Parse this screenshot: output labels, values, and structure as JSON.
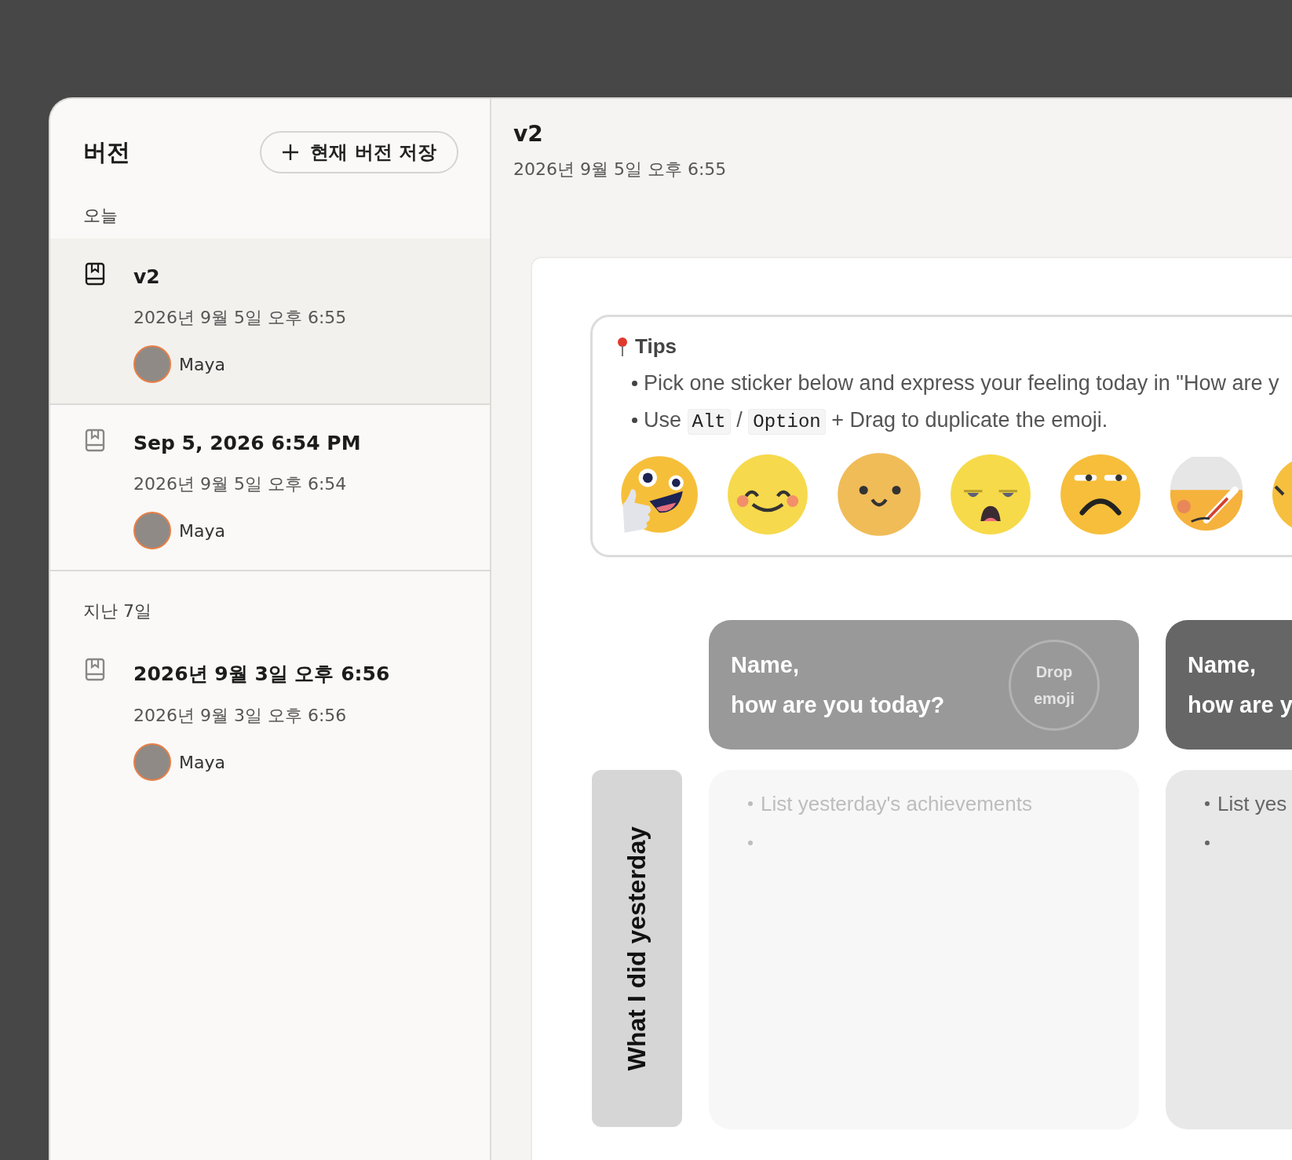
{
  "sidebar": {
    "title": "버전",
    "save_button": "현재 버전 저장",
    "groups": [
      {
        "label": "오늘",
        "items": [
          {
            "title": "v2",
            "timestamp": "2026년 9월 5일 오후 6:55",
            "author": "Maya",
            "selected": true
          },
          {
            "title": "Sep 5, 2026 6:54 PM",
            "timestamp": "2026년 9월 5일 오후 6:54",
            "author": "Maya",
            "selected": false
          }
        ]
      },
      {
        "label": "지난 7일",
        "items": [
          {
            "title": "2026년 9월 3일 오후 6:56",
            "timestamp": "2026년 9월 3일 오후 6:56",
            "author": "Maya",
            "selected": false
          }
        ]
      }
    ]
  },
  "preview": {
    "title": "v2",
    "timestamp": "2026년 9월 5일 오후 6:55",
    "tips": {
      "title": "Tips",
      "items": [
        {
          "kind": "plain",
          "text": "Pick one sticker below and express your feeling today in \"How are y"
        },
        {
          "kind": "keys",
          "before": "Use",
          "keys": [
            "Alt",
            "Option"
          ],
          "separator": "/",
          "after": "+ Drag to duplicate the emoji."
        }
      ],
      "stickers": [
        {
          "kind": "thumbs-up"
        },
        {
          "kind": "blushing"
        },
        {
          "kind": "smile"
        },
        {
          "kind": "tired"
        },
        {
          "kind": "frown"
        },
        {
          "kind": "sick"
        },
        {
          "kind": "edge"
        }
      ]
    },
    "row_label": "What I did yesterday",
    "cards": [
      {
        "kind": "light",
        "line1": "Name,",
        "line2": "how are you today?",
        "drop_zone": "Drop emoji"
      },
      {
        "kind": "dark",
        "line1": "Name,",
        "line2": "how are y"
      }
    ],
    "lists": [
      {
        "kind": "light",
        "bullets": [
          {
            "kind": "text",
            "text": "List yesterday's achievements"
          },
          {
            "kind": "empty"
          }
        ]
      },
      {
        "kind": "dark",
        "bullets": [
          {
            "kind": "text",
            "text": "List yes"
          },
          {
            "kind": "empty"
          }
        ]
      }
    ]
  }
}
